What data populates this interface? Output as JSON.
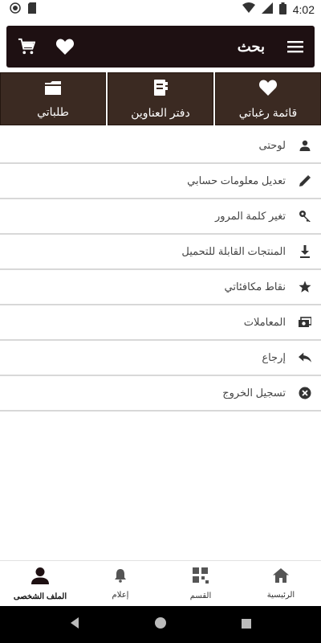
{
  "status_bar": {
    "time": "4:02"
  },
  "app_bar": {
    "title": "بحث"
  },
  "tiles": [
    {
      "label": "طلباتي",
      "icon": "folder-icon"
    },
    {
      "label": "دفتر العناوين",
      "icon": "address-book-icon"
    },
    {
      "label": "قائمة رغباتي",
      "icon": "heart-icon"
    }
  ],
  "menu": [
    {
      "label": "لوحتى",
      "icon": "person-icon"
    },
    {
      "label": "تعديل معلومات حسابي",
      "icon": "pencil-icon"
    },
    {
      "label": "تغير كلمة المرور",
      "icon": "key-icon"
    },
    {
      "label": "المنتجات القابلة للتحميل",
      "icon": "download-icon"
    },
    {
      "label": "نقاط مكافئاتي",
      "icon": "star-icon"
    },
    {
      "label": "المعاملات",
      "icon": "money-icon"
    },
    {
      "label": "إرجاع",
      "icon": "reply-icon"
    },
    {
      "label": "تسجيل الخروج",
      "icon": "close-circle-icon"
    }
  ],
  "bottom_nav": [
    {
      "label": "الملف الشخصى",
      "icon": "profile-icon",
      "active": true
    },
    {
      "label": "إعلام",
      "icon": "bell-icon"
    },
    {
      "label": "القسم",
      "icon": "category-icon"
    },
    {
      "label": "الرئيسية",
      "icon": "home-icon"
    }
  ],
  "colors": {
    "app_bar_bg": "#1e1012",
    "tile_bg": "#3b2a22",
    "divider": "#d8d8d8"
  }
}
